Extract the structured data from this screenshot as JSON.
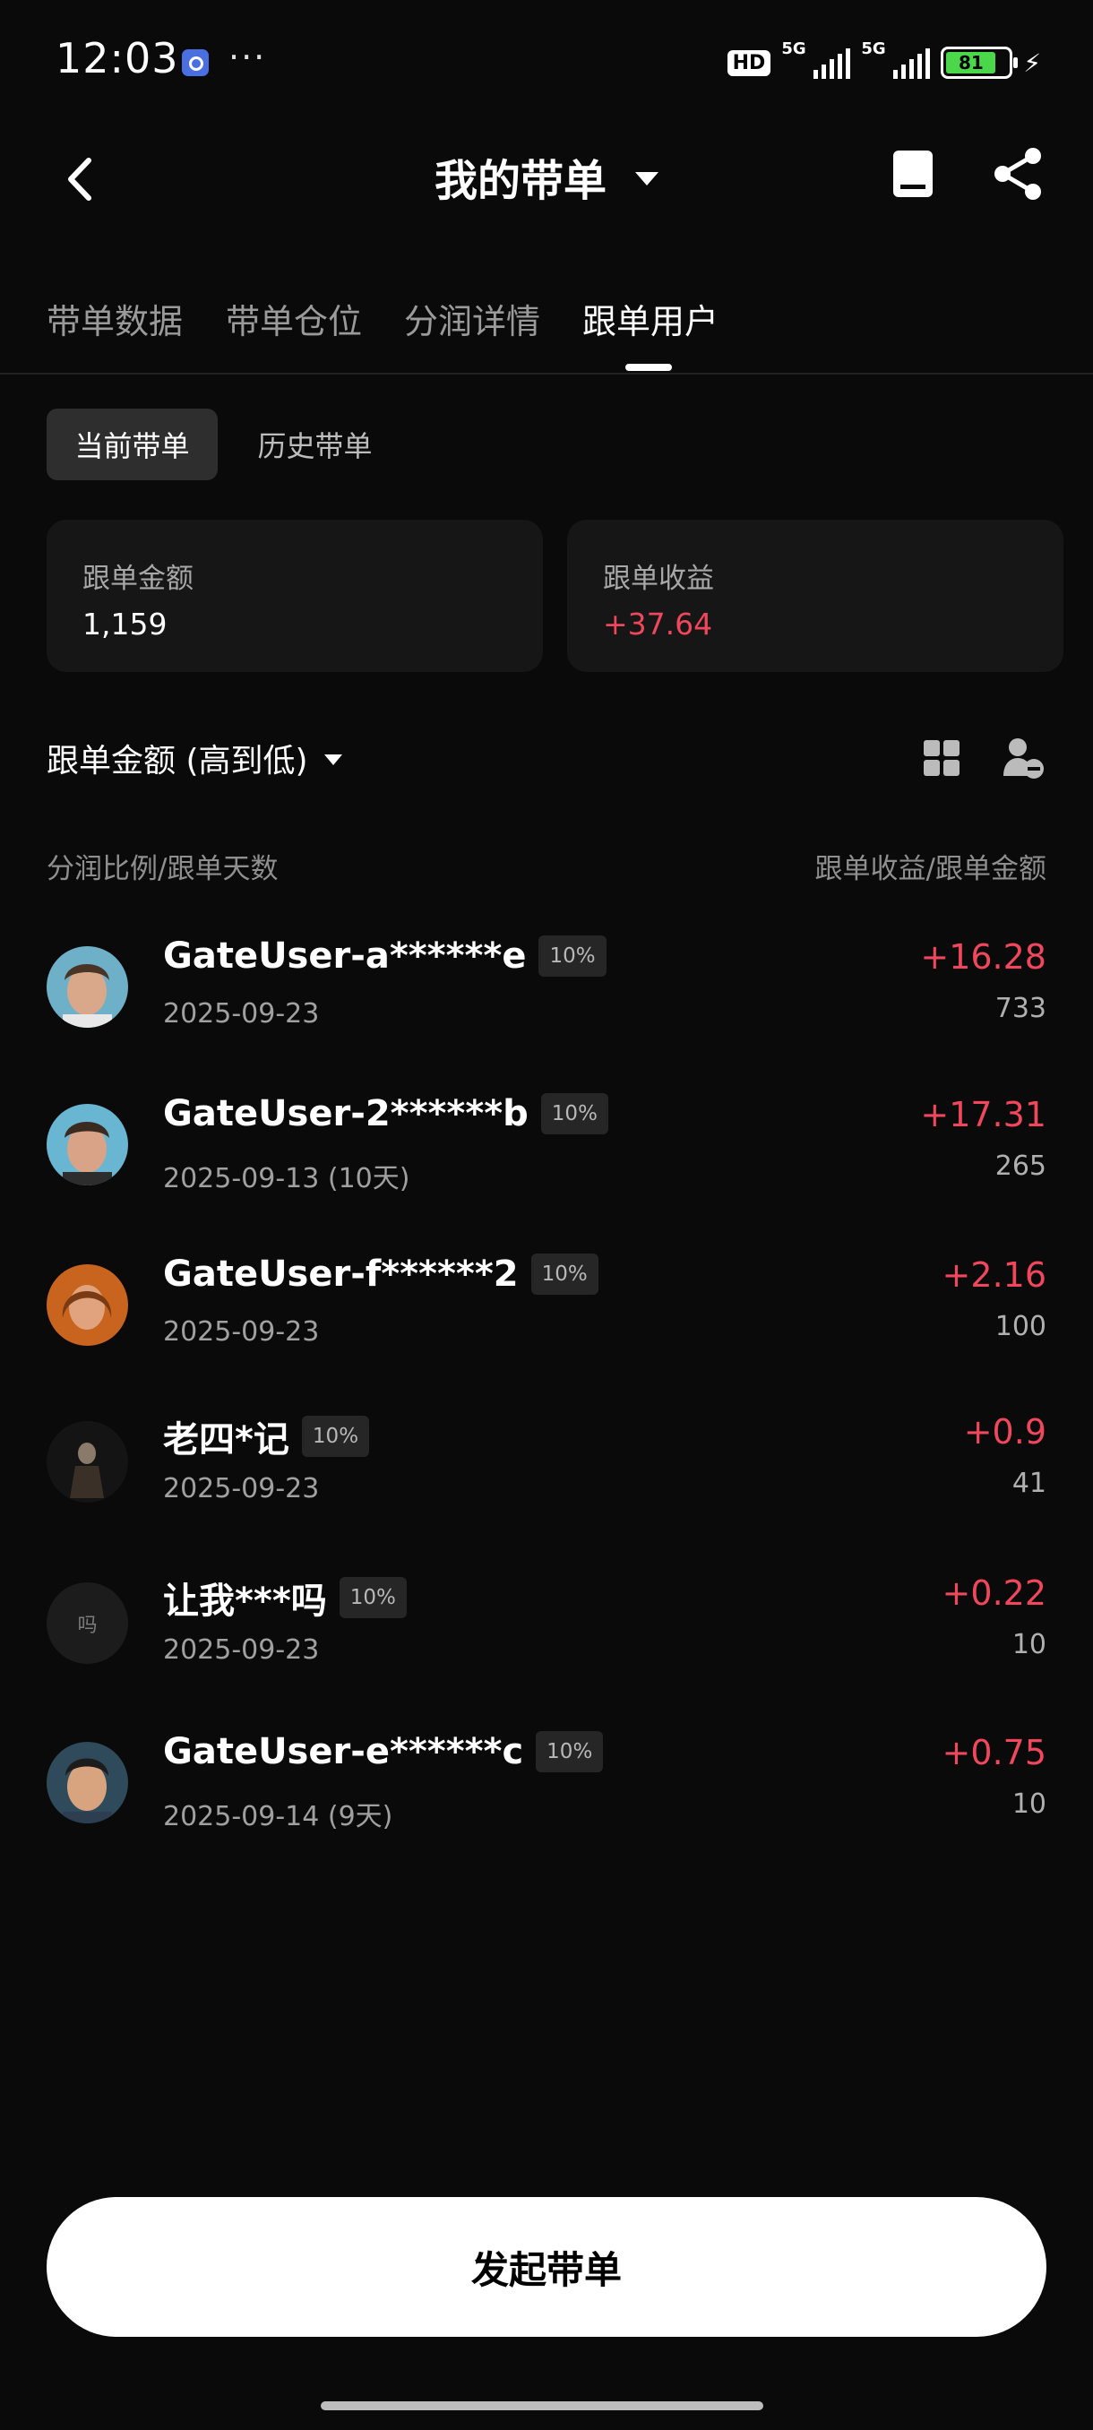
{
  "status_bar": {
    "time": "12:03",
    "more": "···",
    "hd": "HD",
    "network1": "5G",
    "network2": "5G",
    "battery": "81"
  },
  "header": {
    "title": "我的带单"
  },
  "tabs": [
    {
      "label": "带单数据",
      "active": false
    },
    {
      "label": "带单仓位",
      "active": false
    },
    {
      "label": "分润详情",
      "active": false
    },
    {
      "label": "跟单用户",
      "active": true
    }
  ],
  "segments": {
    "current": "当前带单",
    "history": "历史带单"
  },
  "summary": {
    "amount_label": "跟单金额",
    "amount_value": "1,159",
    "profit_label": "跟单收益",
    "profit_value": "+37.64"
  },
  "sort": {
    "label": "跟单金额 (高到低)"
  },
  "columns": {
    "left": "分润比例/跟单天数",
    "right": "跟单收益/跟单金额"
  },
  "followers": [
    {
      "name": "GateUser-a******e",
      "ratio": "10%",
      "date": "2025-09-23",
      "profit": "+16.28",
      "amount": "733"
    },
    {
      "name": "GateUser-2******b",
      "ratio": "10%",
      "date": "2025-09-13 (10天)",
      "profit": "+17.31",
      "amount": "265"
    },
    {
      "name": "GateUser-f******2",
      "ratio": "10%",
      "date": "2025-09-23",
      "profit": "+2.16",
      "amount": "100"
    },
    {
      "name": "老四*记",
      "ratio": "10%",
      "date": "2025-09-23",
      "profit": "+0.9",
      "amount": "41"
    },
    {
      "name": "让我***吗",
      "ratio": "10%",
      "date": "2025-09-23",
      "profit": "+0.22",
      "amount": "10",
      "avatar_text": "吗"
    },
    {
      "name": "GateUser-e******c",
      "ratio": "10%",
      "date": "2025-09-14 (9天)",
      "profit": "+0.75",
      "amount": "10"
    }
  ],
  "bottom": {
    "button": "发起带单"
  },
  "colors": {
    "positive": "#f0475c",
    "background": "#0a0a0a",
    "card": "#161616"
  }
}
